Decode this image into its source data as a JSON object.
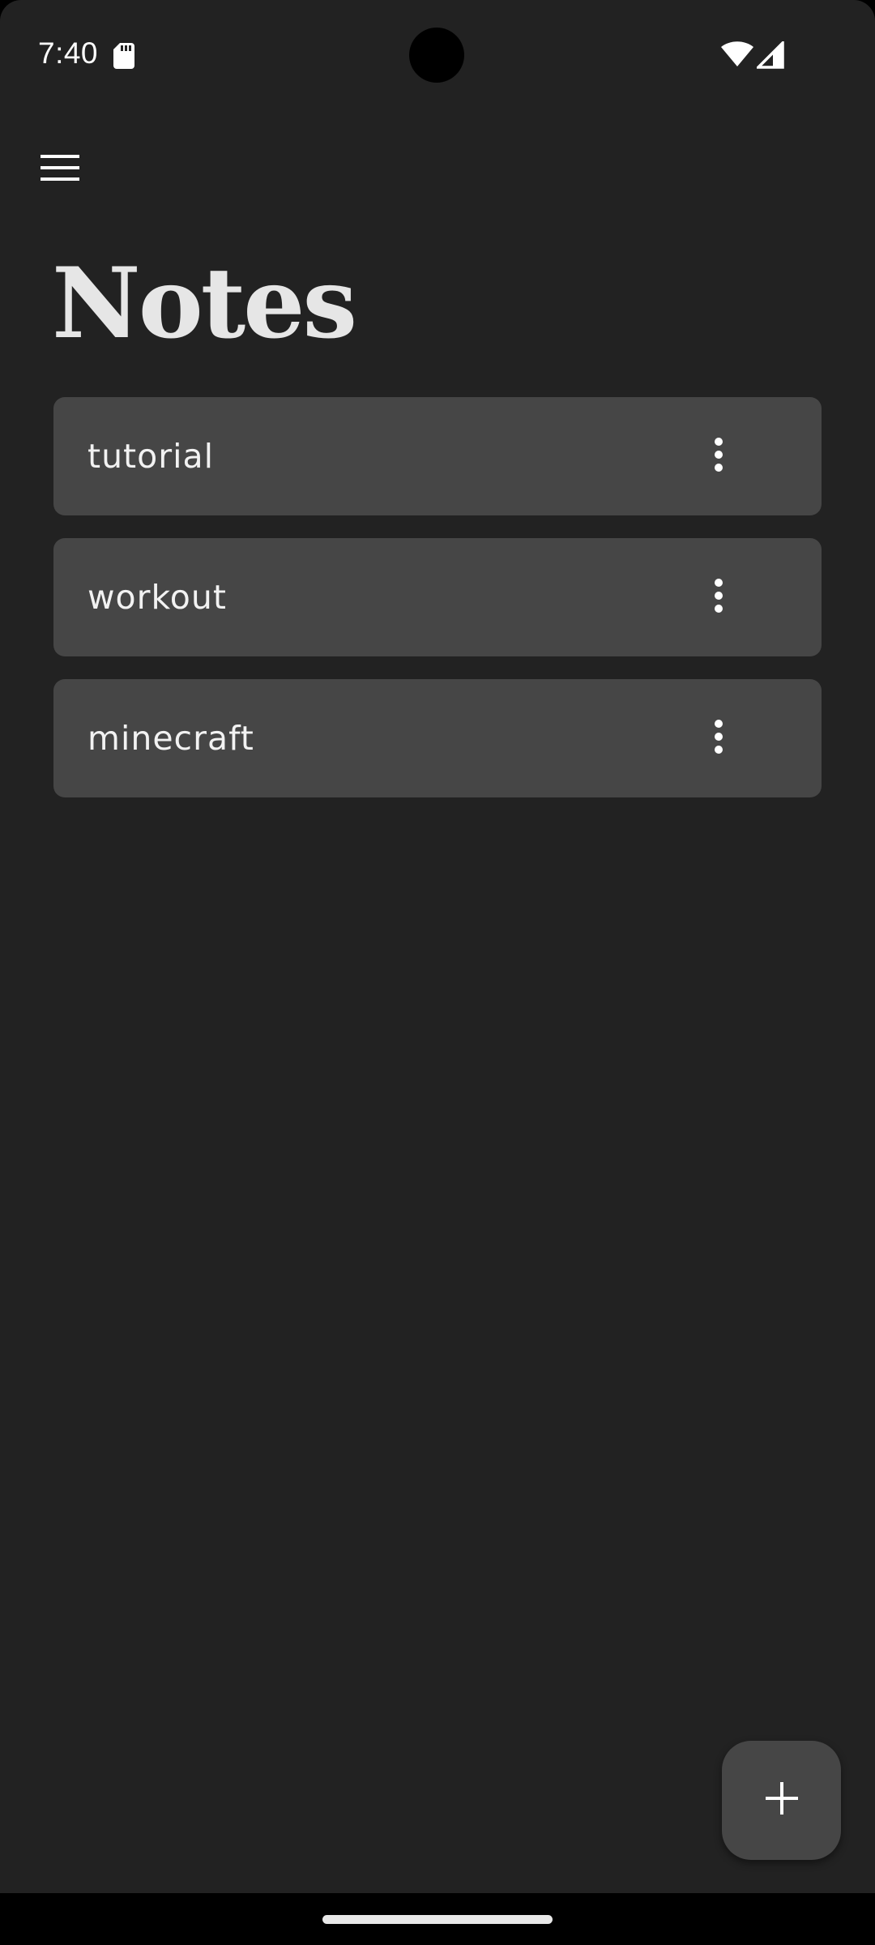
{
  "status_bar": {
    "time": "7:40",
    "icons": [
      "sd-card-icon",
      "wifi-icon",
      "cell-signal-icon"
    ]
  },
  "app_bar": {
    "menu_icon": "menu-icon"
  },
  "page": {
    "title": "Notes"
  },
  "notes": [
    {
      "title": "tutorial",
      "menu_icon": "more-vert-icon"
    },
    {
      "title": "workout",
      "menu_icon": "more-vert-icon"
    },
    {
      "title": "minecraft",
      "menu_icon": "more-vert-icon"
    }
  ],
  "fab": {
    "icon": "plus-icon"
  },
  "colors": {
    "background": "#222222",
    "card": "#464646",
    "title_text": "#e6e6e6",
    "note_text": "#f2f2f2",
    "fab": "#464646"
  }
}
